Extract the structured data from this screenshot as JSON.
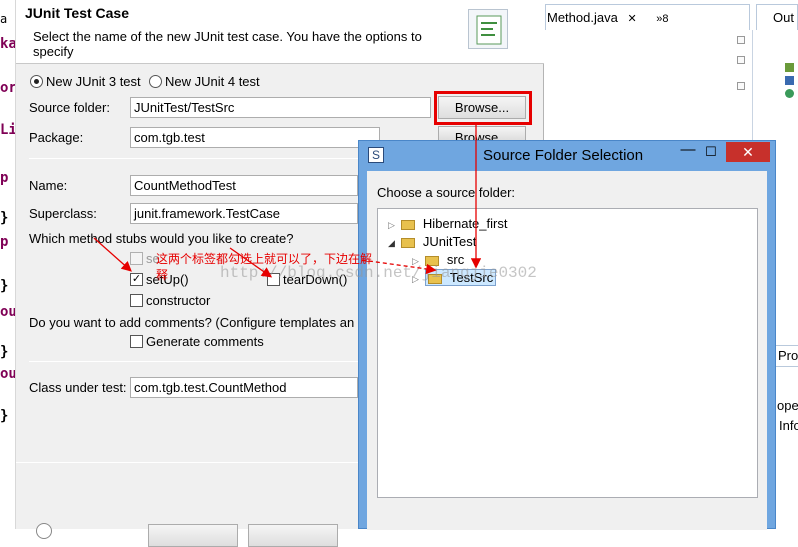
{
  "editor_left": {
    "fragments": [
      "a",
      "ka",
      "or",
      "Li",
      "p",
      "}",
      "p",
      "}",
      "ou",
      "}",
      "ou",
      "}"
    ]
  },
  "wizard": {
    "title": "JUnit Test Case",
    "description": "Select the name of the new JUnit test case. You have the options to specify",
    "radio_junit3": "New JUnit 3 test",
    "radio_junit4": "New JUnit 4 test",
    "source_folder_label": "Source folder:",
    "source_folder_value": "JUnitTest/TestSrc",
    "browse_label": "Browse...",
    "package_label": "Package:",
    "package_value": "com.tgb.test",
    "name_label": "Name:",
    "name_value": "CountMethodTest",
    "superclass_label": "Superclass:",
    "superclass_value": "junit.framework.TestCase",
    "stubs_question": "Which method stubs would you like to create?",
    "stub_setup_before_class": "se",
    "stub_setup": "setUp()",
    "stub_teardown": "tearDown()",
    "stub_constructor": "constructor",
    "comments_question": "Do you want to add comments? (Configure templates an",
    "generate_comments": "Generate comments",
    "class_under_test_label": "Class under test:",
    "class_under_test_value": "com.tgb.test.CountMethod"
  },
  "editor_right": {
    "tab_label": "Method.java",
    "tab_close": "✕",
    "tab_overflow": "»8",
    "outline_label": "Out",
    "prop_label": "Prop",
    "oper_label": "oper",
    "info_label": "Info"
  },
  "source_folder_dialog": {
    "title": "Source Folder Selection",
    "minimize": "—",
    "maximize": "☐",
    "close": "✕",
    "prompt": "Choose a source folder:",
    "tree": [
      {
        "label": "Hibernate_first",
        "expanded": false
      },
      {
        "label": "JUnitTest",
        "expanded": true
      },
      {
        "label": "src"
      },
      {
        "label": "TestSrc",
        "selected": true
      }
    ]
  },
  "annotation": {
    "text_line1": "这两个标签都勾选上就可以了，下边在解",
    "text_line2": "释",
    "watermark": "http://blog.csdn.net/jiangjie0302"
  },
  "colors": {
    "accent_red": "#e60000",
    "selection": "#cce8ff",
    "titlebar": "#6fa6e0"
  }
}
